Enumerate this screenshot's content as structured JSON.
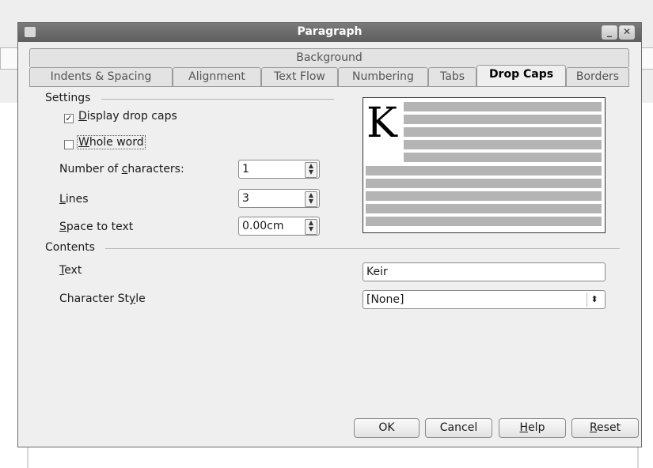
{
  "window": {
    "title": "Paragraph",
    "minimize_glyph": "_",
    "close_glyph": "✕"
  },
  "tabs": {
    "row_top": [
      "Background"
    ],
    "row_bottom": [
      "Indents & Spacing",
      "Alignment",
      "Text Flow",
      "Numbering",
      "Tabs",
      "Drop Caps",
      "Borders"
    ],
    "active": "Drop Caps"
  },
  "settings": {
    "heading": "Settings",
    "display_drop_caps": {
      "label_pre": "",
      "label_ul": "D",
      "label_post": "isplay drop caps",
      "checked": true
    },
    "whole_word": {
      "label_pre": "",
      "label_ul": "W",
      "label_post": "hole word",
      "checked": false
    },
    "num_chars": {
      "label_pre": "Number of ",
      "label_ul": "c",
      "label_post": "haracters:",
      "value": "1"
    },
    "lines": {
      "label_pre": "",
      "label_ul": "L",
      "label_post": "ines",
      "value": "3"
    },
    "space": {
      "label_pre": "",
      "label_ul": "S",
      "label_post": "pace to text",
      "value": "0.00cm"
    }
  },
  "preview": {
    "drop_letter": "K"
  },
  "contents": {
    "heading": "Contents",
    "text": {
      "label_pre": "",
      "label_ul": "T",
      "label_post": "ext",
      "value": "Keir"
    },
    "char_style": {
      "label_pre": "Character St",
      "label_ul": "y",
      "label_post": "le",
      "value": "[None]"
    }
  },
  "buttons": {
    "ok": "OK",
    "cancel": "Cancel",
    "help": {
      "pre": "",
      "ul": "H",
      "post": "elp"
    },
    "reset": {
      "pre": "",
      "ul": "R",
      "post": "eset"
    }
  },
  "icons": [
    "app-icon",
    "minimize-icon",
    "close-icon",
    "check-icon",
    "spin-arrows-icon",
    "select-arrows-icon"
  ]
}
